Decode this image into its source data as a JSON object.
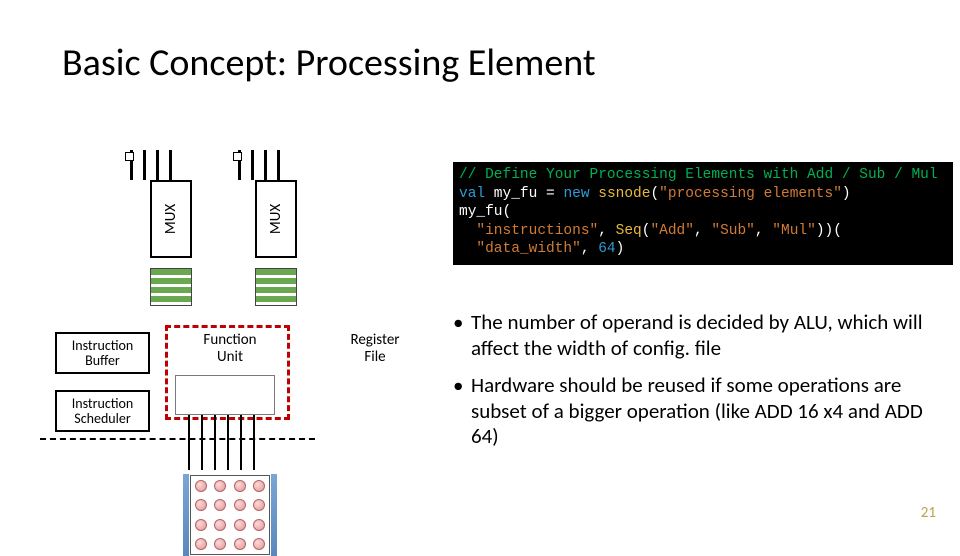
{
  "title": "Basic Concept: Processing Element",
  "diagram": {
    "mux1": "MUX",
    "mux2": "MUX",
    "instruction_buffer": "Instruction\nBuffer",
    "instruction_scheduler": "Instruction\nScheduler",
    "function_unit": "Function\nUnit",
    "register_file": "Register\nFile"
  },
  "code": {
    "comment": "// Define Your Processing Elements with Add / Sub / Mul",
    "l1_a": "val",
    "l1_b": " my_fu = ",
    "l1_c": "new",
    "l1_d": " ",
    "l1_e": "ssnode",
    "l1_f": "(",
    "l1_g": "\"processing elements\"",
    "l1_h": ")",
    "l2": "my_fu(",
    "l3_a": "  ",
    "l3_b": "\"instructions\"",
    "l3_c": ", ",
    "l3_d": "Seq",
    "l3_e": "(",
    "l3_f": "\"Add\"",
    "l3_g": ", ",
    "l3_h": "\"Sub\"",
    "l3_i": ", ",
    "l3_j": "\"Mul\"",
    "l3_k": "))(",
    "l4_a": "  ",
    "l4_b": "\"data_width\"",
    "l4_c": ", ",
    "l4_d": "64",
    "l4_e": ")"
  },
  "bullets": [
    "The number of operand is decided by ALU, which will affect the width of config. file",
    "Hardware should be reused if some operations are subset of a bigger operation (like ADD 16 x4 and ADD 64)"
  ],
  "page_number": "21"
}
